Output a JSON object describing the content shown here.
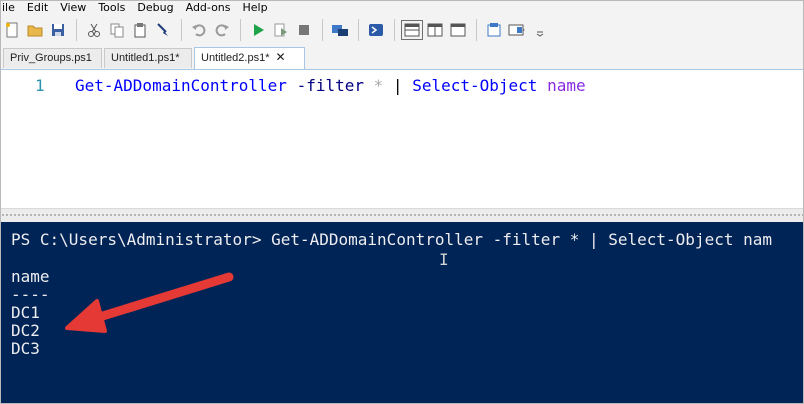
{
  "menu": [
    "ile",
    "Edit",
    "View",
    "Tools",
    "Debug",
    "Add-ons",
    "Help"
  ],
  "tabs": [
    {
      "label": "Priv_Groups.ps1"
    },
    {
      "label": "Untitled1.ps1*"
    },
    {
      "label": "Untitled2.ps1*",
      "close": "✕"
    }
  ],
  "editor": {
    "line_number": "1",
    "tokens": {
      "cmdlet1": "Get-ADDomainController",
      "param": "-filter",
      "star": "*",
      "pipe": "|",
      "cmdlet2": "Select-Object",
      "arg": "name"
    }
  },
  "console": {
    "prompt": "PS C:\\Users\\Administrator> Get-ADDomainController -filter * | Select-Object nam",
    "header": "name",
    "underline": "----",
    "rows": [
      "DC1",
      "DC2",
      "DC3"
    ]
  },
  "colors": {
    "console_bg": "#012456",
    "arrow": "#e53935",
    "cmdlet": "#0000ff"
  }
}
